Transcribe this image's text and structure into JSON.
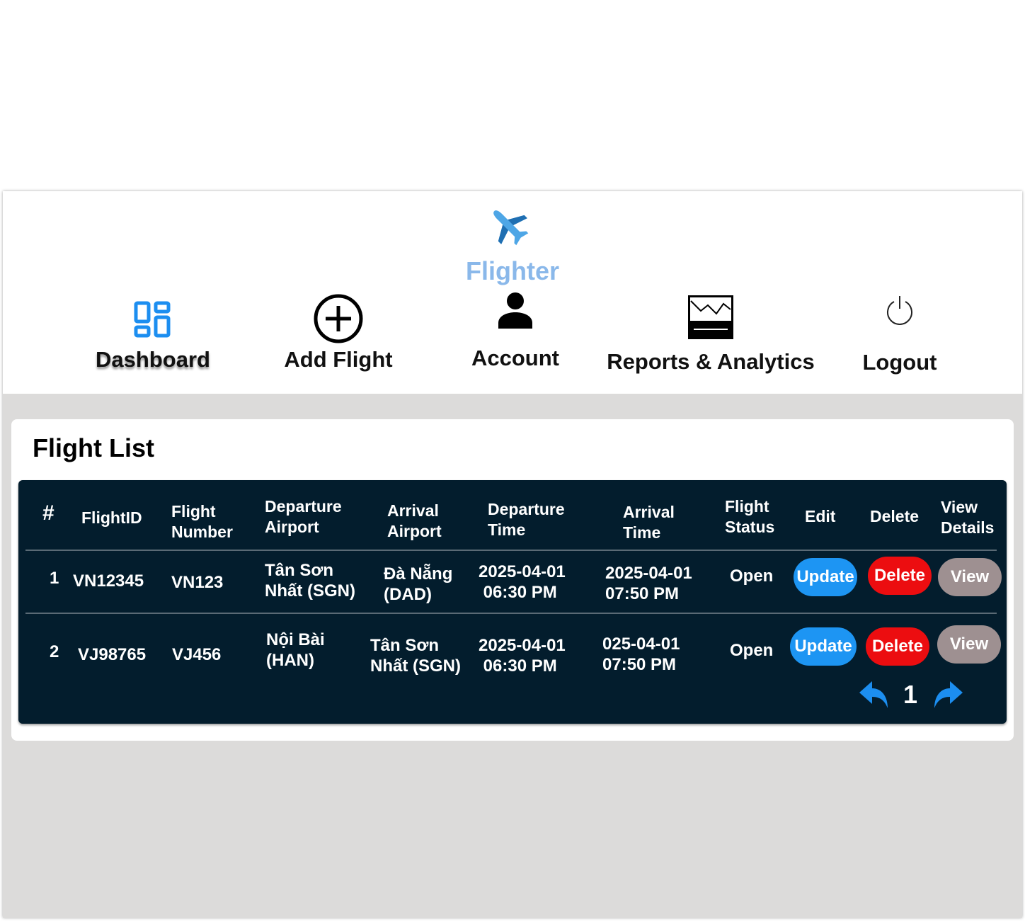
{
  "app": {
    "name": "Flighter"
  },
  "nav": {
    "dashboard": "Dashboard",
    "add_flight": "Add Flight",
    "account": "Account",
    "reports": "Reports & Analytics",
    "logout": "Logout"
  },
  "flight_list": {
    "title": "Flight List",
    "columns": {
      "num": "#",
      "flight_id": "FlightID",
      "flight_number": [
        "Flight",
        "Number"
      ],
      "departure_airport": [
        "Departure",
        "Airport"
      ],
      "arrival_airport": [
        "Arrival",
        "Airport"
      ],
      "departure_time": [
        "Departure",
        "Time"
      ],
      "arrival_time": [
        "Arrival",
        "Time"
      ],
      "flight_status": [
        "Flight",
        "Status"
      ],
      "edit": "Edit",
      "delete": "Delete",
      "view_details": [
        "View",
        "Details"
      ]
    },
    "rows": [
      {
        "num": "1",
        "flight_id": "VN12345",
        "flight_number": "VN123",
        "departure_airport": [
          "Tân Sơn",
          "Nhất (SGN)"
        ],
        "arrival_airport": [
          "Đà Nẵng",
          "(DAD)"
        ],
        "departure_time": [
          "2025-04-01",
          "06:30 PM"
        ],
        "arrival_time": [
          "2025-04-01",
          "07:50 PM"
        ],
        "status": "Open",
        "update_label": "Update",
        "delete_label": "Delete",
        "view_label": "View"
      },
      {
        "num": "2",
        "flight_id": "VJ98765",
        "flight_number": "VJ456",
        "departure_airport": [
          "Nội Bài",
          "(HAN)"
        ],
        "arrival_airport": [
          "Tân Sơn",
          "Nhất (SGN)"
        ],
        "departure_time": [
          "2025-04-01",
          "06:30 PM"
        ],
        "arrival_time": [
          "025-04-01",
          "07:50 PM"
        ],
        "status": "Open",
        "update_label": "Update",
        "delete_label": "Delete",
        "view_label": "View"
      }
    ],
    "pagination": {
      "current_page": "1"
    }
  },
  "colors": {
    "brand": "#8ab8ea",
    "panel": "#031d2d",
    "update": "#1d95f3",
    "delete": "#ec0d10",
    "view": "#9e9091",
    "dashboard_icon": "#1c8ef0",
    "pager_arrow": "#1c8ef0"
  },
  "icons": {
    "logo": "airplane-icon",
    "dashboard": "dashboard-grid-icon",
    "add_flight": "plus-circle-icon",
    "account": "user-icon",
    "reports": "chart-icon",
    "logout": "power-icon",
    "prev": "arrow-left-icon",
    "next": "arrow-right-icon"
  }
}
